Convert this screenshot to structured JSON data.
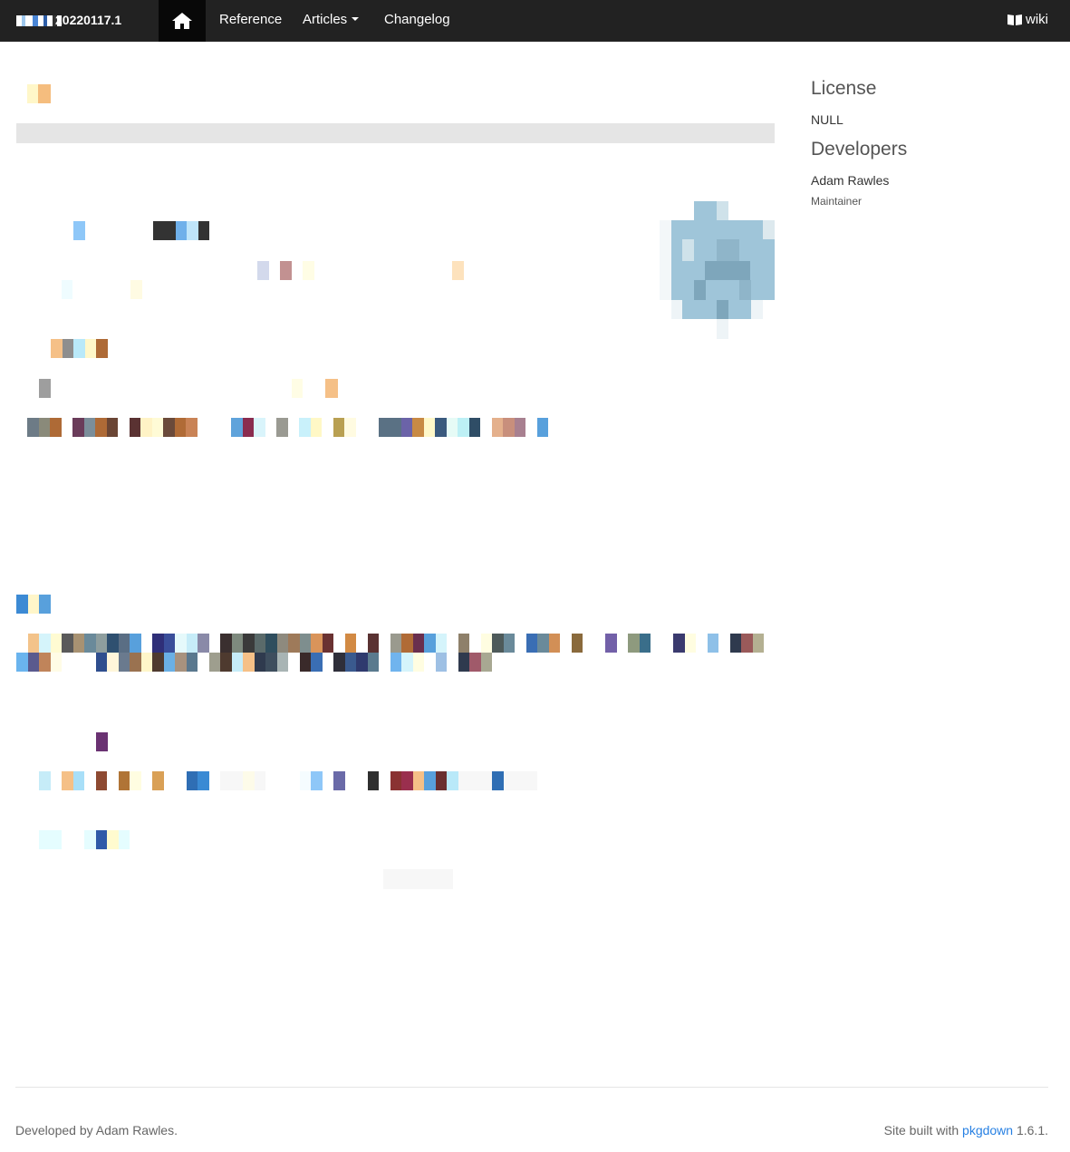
{
  "navbar": {
    "version": "20220117.1",
    "home_icon": "home-icon",
    "links": [
      {
        "label": "Reference"
      },
      {
        "label": "Articles"
      },
      {
        "label": "Changelog"
      }
    ],
    "wiki_icon": "book-icon",
    "wiki_label": "wiki",
    "background": "#222222",
    "active_background": "#080808"
  },
  "sidebar": {
    "license_heading": "License",
    "license_value": "NULL",
    "developers_heading": "Developers",
    "developer_name": "Adam Rawles",
    "developer_role": "Maintainer"
  },
  "footer": {
    "developed_by": "Developed by Adam Rawles.",
    "site_built_prefix": "Site built with",
    "site_built_link": "pkgdown",
    "site_built_suffix": "1.6.1."
  },
  "colors": {
    "link": "#2780e3",
    "redaction_bar": "#e5e5e5",
    "logo": "#9fc5d9"
  }
}
